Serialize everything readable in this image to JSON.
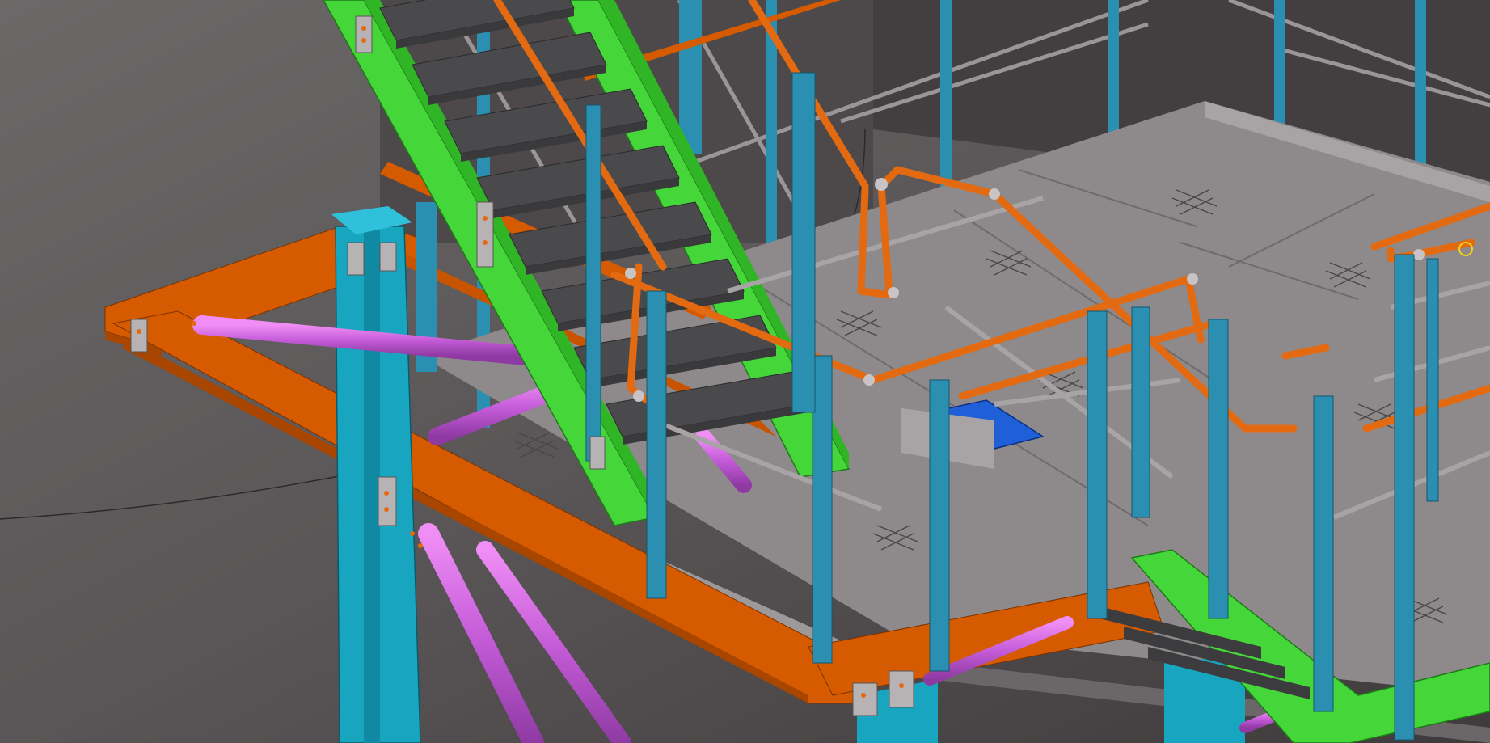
{
  "viewport": {
    "background_colors": [
      "#6b6868",
      "#4a4647",
      "#3f3b3c"
    ]
  },
  "model": {
    "members": [
      {
        "name": "beam",
        "color": "#d65a00",
        "material": "orange-steel"
      },
      {
        "name": "column",
        "color": "#17a5c0",
        "material": "cyan-steel"
      },
      {
        "name": "brace",
        "color": "#c45bd8",
        "material": "purple-pipe"
      },
      {
        "name": "stair-stringer",
        "color": "#45d63a",
        "material": "green-steel"
      },
      {
        "name": "handrail",
        "color": "#e36a10",
        "material": "orange-pipe"
      },
      {
        "name": "rail-post",
        "color": "#2a8fb0",
        "material": "blue-flat"
      },
      {
        "name": "grating",
        "color": "#8e8a8b",
        "material": "grey-plate"
      },
      {
        "name": "stair-tread",
        "color": "#4a4a4c",
        "material": "dark-grating"
      },
      {
        "name": "selected-part",
        "color": "#1f5fd8",
        "material": "blue-highlight"
      }
    ]
  }
}
